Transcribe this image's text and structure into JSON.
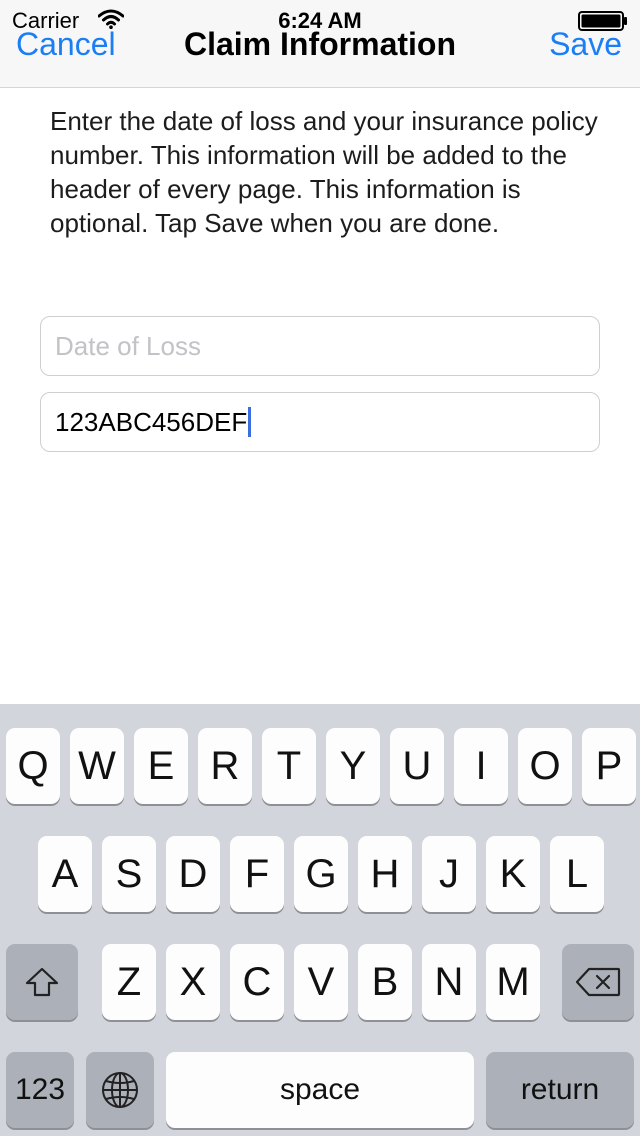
{
  "status_bar": {
    "carrier": "Carrier",
    "time": "6:24 AM",
    "icons": [
      "wifi-icon",
      "battery-icon"
    ]
  },
  "nav": {
    "cancel_label": "Cancel",
    "title": "Claim Information",
    "save_label": "Save",
    "accent_color": "#1a7ef5"
  },
  "instructions": "Enter the date of loss and your insurance policy number. This information will be added to the header of every page. This information is optional. Tap Save when you are done.",
  "form": {
    "date_of_loss": {
      "placeholder": "Date of Loss",
      "value": ""
    },
    "policy_number": {
      "placeholder": "",
      "value": "123ABC456DEF",
      "focused": true
    }
  },
  "keyboard": {
    "row1": [
      "Q",
      "W",
      "E",
      "R",
      "T",
      "Y",
      "U",
      "I",
      "O",
      "P"
    ],
    "row2": [
      "A",
      "S",
      "D",
      "F",
      "G",
      "H",
      "J",
      "K",
      "L"
    ],
    "row3": [
      "Z",
      "X",
      "C",
      "V",
      "B",
      "N",
      "M"
    ],
    "numbers_label": "123",
    "space_label": "space",
    "return_label": "return",
    "icons": [
      "shift-icon",
      "delete-icon",
      "globe-icon"
    ]
  }
}
